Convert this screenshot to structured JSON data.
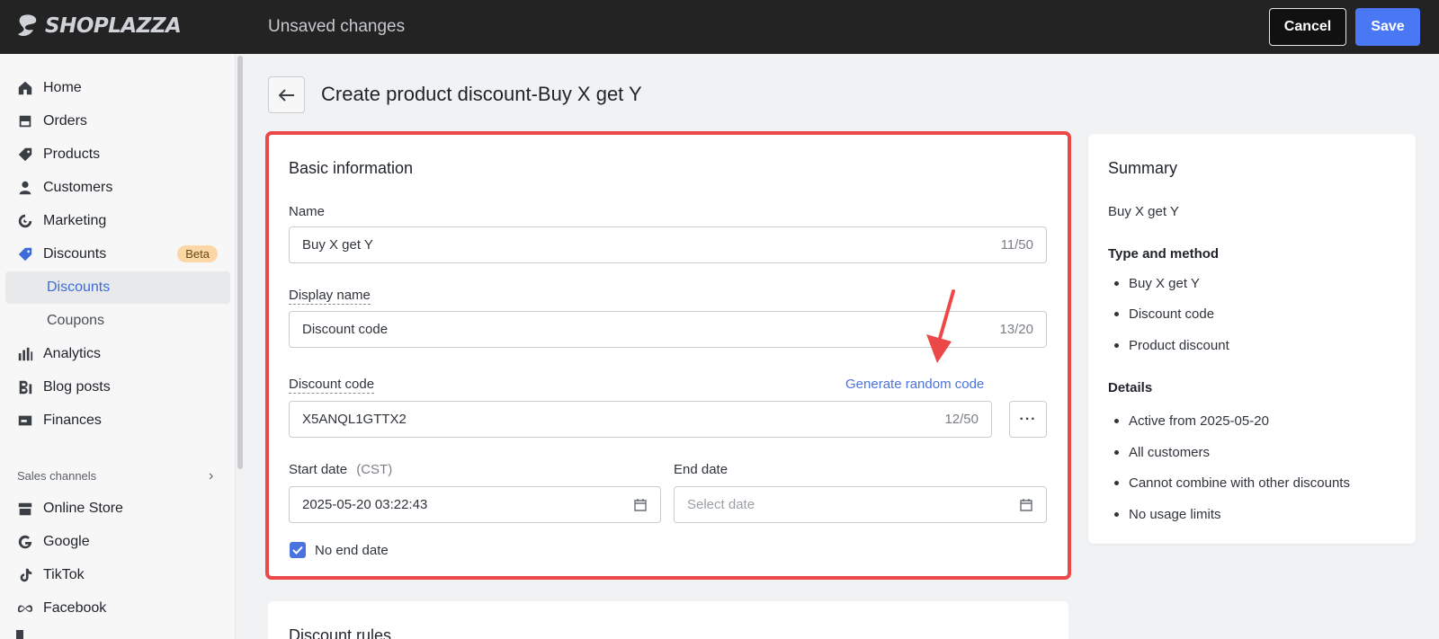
{
  "topbar": {
    "logo_text": "SHOPLAZZA",
    "status": "Unsaved changes",
    "cancel_label": "Cancel",
    "save_label": "Save"
  },
  "sidebar": {
    "items": [
      {
        "label": "Home",
        "icon": "home-icon"
      },
      {
        "label": "Orders",
        "icon": "orders-icon"
      },
      {
        "label": "Products",
        "icon": "tag-icon"
      },
      {
        "label": "Customers",
        "icon": "person-icon"
      },
      {
        "label": "Marketing",
        "icon": "target-icon"
      },
      {
        "label": "Discounts",
        "icon": "discount-icon",
        "badge": "Beta"
      },
      {
        "label": "Analytics",
        "icon": "bar-chart-icon"
      },
      {
        "label": "Blog posts",
        "icon": "blog-icon"
      },
      {
        "label": "Finances",
        "icon": "finance-icon"
      }
    ],
    "subitems": [
      {
        "label": "Discounts",
        "active": true
      },
      {
        "label": "Coupons",
        "active": false
      }
    ],
    "section_label": "Sales channels",
    "channels": [
      {
        "label": "Online Store",
        "icon": "store-icon"
      },
      {
        "label": "Google",
        "icon": "google-icon"
      },
      {
        "label": "TikTok",
        "icon": "tiktok-icon"
      },
      {
        "label": "Facebook",
        "icon": "meta-icon"
      }
    ]
  },
  "page": {
    "title": "Create product discount-Buy X get Y"
  },
  "basic": {
    "title": "Basic information",
    "name_label": "Name",
    "name_value": "Buy X get Y",
    "name_count": "11/50",
    "display_label": "Display name",
    "display_value": "Discount code",
    "display_count": "13/20",
    "code_label": "Discount code",
    "generate_link": "Generate random code",
    "code_value": "X5ANQL1GTTX2",
    "code_count": "12/50",
    "more_label": "···",
    "start_label": "Start date",
    "start_tz": "(CST)",
    "start_value": "2025-05-20 03:22:43",
    "end_label": "End date",
    "end_placeholder": "Select date",
    "no_end_label": "No end date",
    "no_end_checked": true
  },
  "summary": {
    "title": "Summary",
    "name": "Buy X get Y",
    "type_head": "Type and method",
    "type_items": [
      "Buy X get Y",
      "Discount code",
      "Product discount"
    ],
    "details_head": "Details",
    "details_items": [
      "Active from 2025-05-20",
      "All customers",
      "Cannot combine with other discounts",
      "No usage limits"
    ]
  },
  "rules": {
    "title": "Discount rules"
  },
  "colors": {
    "accent": "#4a78f5",
    "highlight": "#ec4848",
    "topbar": "#232323"
  }
}
